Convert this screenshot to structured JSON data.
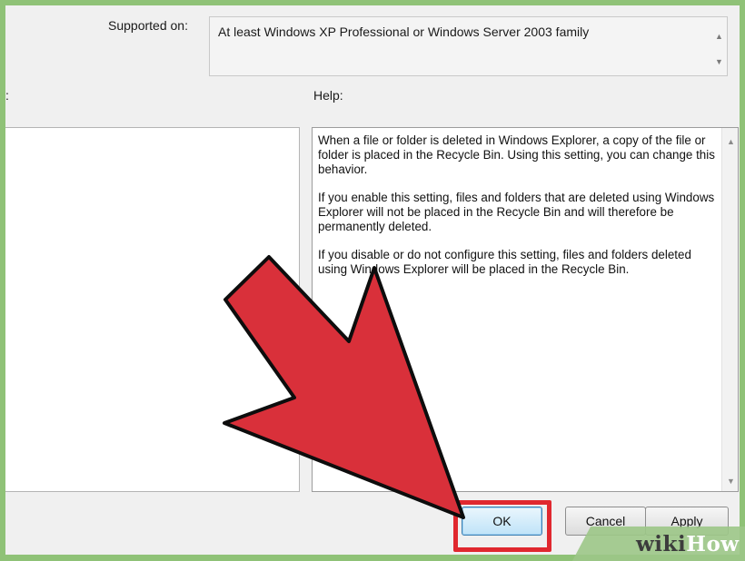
{
  "policy": {
    "supported_label": "Supported on:",
    "supported_value": "At least Windows XP Professional or Windows Server 2003 family",
    "options_label": ":",
    "help_label": "Help:",
    "help_paragraphs": [
      "When a file or folder is deleted in Windows Explorer, a copy of the file or folder is placed in the Recycle Bin. Using this setting, you can change this behavior.",
      "If you enable this setting, files and folders that are deleted using Windows Explorer will not be placed in the Recycle Bin and will therefore be permanently deleted.",
      "If you disable or do not configure this setting, files and folders deleted using Windows Explorer will be placed in the Recycle Bin."
    ]
  },
  "buttons": {
    "ok": "OK",
    "cancel": "Cancel",
    "apply": "Apply"
  },
  "watermark": {
    "wiki": "wiki",
    "how": "How"
  },
  "colors": {
    "frame": "#8fc277",
    "highlight": "#e0282f",
    "arrow_fill": "#d9303a"
  }
}
